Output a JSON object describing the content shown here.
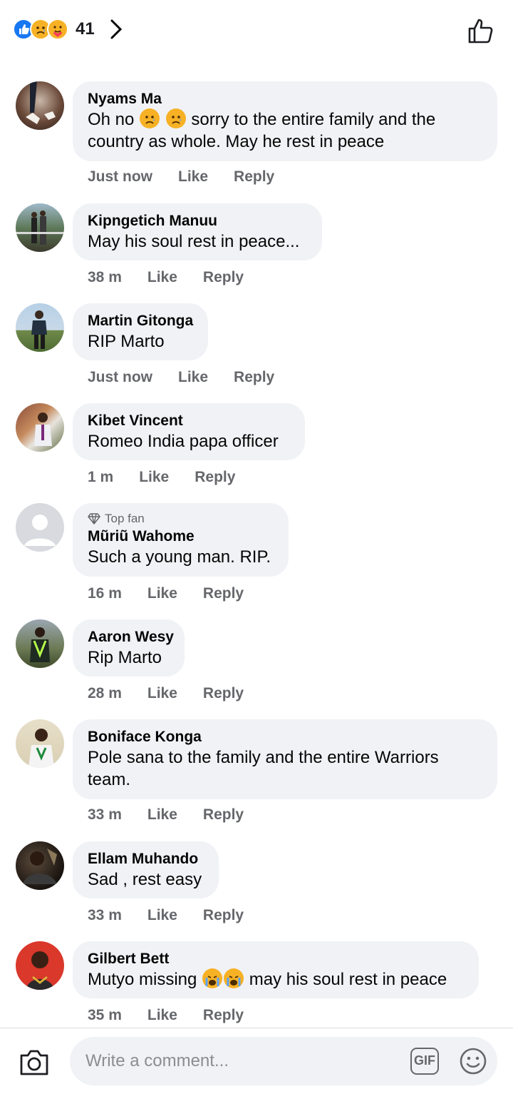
{
  "header": {
    "reaction_count": "41",
    "reactions": [
      "like-icon",
      "sad-icon",
      "care-icon"
    ]
  },
  "comments": [
    {
      "name": "Nyams Ma",
      "text_parts": [
        "Oh no ",
        " ",
        " sorry to the entire family and the country as whole. May he rest in peace"
      ],
      "emoji": [
        "sad-icon",
        "sad-icon"
      ],
      "time": "Just now",
      "like": "Like",
      "reply": "Reply"
    },
    {
      "name": "Kipngetich Manuu",
      "text": "May his soul rest in peace...",
      "time": "38 m",
      "like": "Like",
      "reply": "Reply"
    },
    {
      "name": "Martin Gitonga",
      "text": "RIP Marto",
      "time": "Just now",
      "like": "Like",
      "reply": "Reply"
    },
    {
      "name": "Kibet Vincent",
      "text": "Romeo India papa officer",
      "time": "1 m",
      "like": "Like",
      "reply": "Reply"
    },
    {
      "badge": "Top fan",
      "name": "Mũriũ Wahome",
      "text": "Such a young man. RIP.",
      "time": "16 m",
      "like": "Like",
      "reply": "Reply"
    },
    {
      "name": "Aaron Wesy",
      "text": "Rip Marto",
      "time": "28 m",
      "like": "Like",
      "reply": "Reply"
    },
    {
      "name": "Boniface Konga",
      "text": "Pole sana to the family and the entire Warriors team.",
      "time": "33 m",
      "like": "Like",
      "reply": "Reply"
    },
    {
      "name": "Ellam Muhando",
      "text": "Sad , rest easy",
      "time": "33 m",
      "like": "Like",
      "reply": "Reply"
    },
    {
      "name": "Gilbert Bett",
      "text_parts": [
        "Mutyo missing ",
        " may his soul rest in peace"
      ],
      "emoji": [
        "crying-icon",
        "crying-icon"
      ],
      "time": "35 m",
      "like": "Like",
      "reply": "Reply"
    }
  ],
  "composer": {
    "placeholder": "Write a comment...",
    "gif_label": "GIF"
  }
}
